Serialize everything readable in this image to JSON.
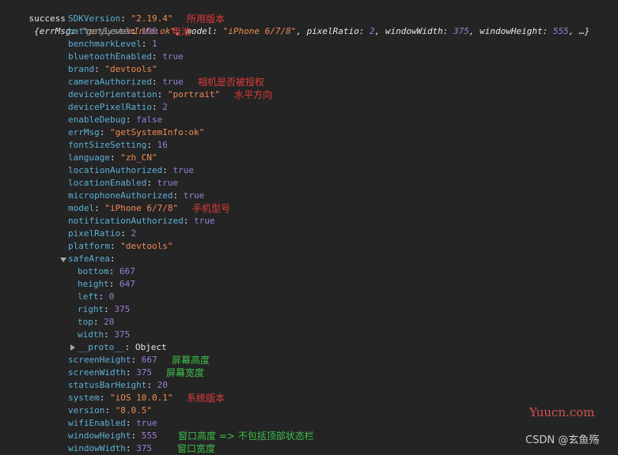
{
  "summary": {
    "label": "success",
    "text_prefix": "{",
    "items": [
      {
        "key": "errMsg",
        "value": "\"getSystemInfo:ok\"",
        "kind": "string"
      },
      {
        "key": "model",
        "value": "\"iPhone 6/7/8\"",
        "kind": "string"
      },
      {
        "key": "pixelRatio",
        "value": "2",
        "kind": "number"
      },
      {
        "key": "windowWidth",
        "value": "375",
        "kind": "number"
      },
      {
        "key": "windowHeight",
        "value": "555",
        "kind": "number"
      }
    ],
    "suffix": ", …}"
  },
  "properties": [
    {
      "key": "SDKVersion",
      "value": "\"2.19.4\"",
      "kind": "string",
      "note": "所用版本",
      "note_color": "red"
    },
    {
      "key": "batteryLevel",
      "value": "100",
      "kind": "number",
      "note": "电池",
      "note_color": "red"
    },
    {
      "key": "benchmarkLevel",
      "value": "1",
      "kind": "number"
    },
    {
      "key": "bluetoothEnabled",
      "value": "true",
      "kind": "bool"
    },
    {
      "key": "brand",
      "value": "\"devtools\"",
      "kind": "string"
    },
    {
      "key": "cameraAuthorized",
      "value": "true",
      "kind": "bool",
      "note": "相机是否被授权",
      "note_color": "red"
    },
    {
      "key": "deviceOrientation",
      "value": "\"portrait\"",
      "kind": "string",
      "note": "水平方向",
      "note_color": "red"
    },
    {
      "key": "devicePixelRatio",
      "value": "2",
      "kind": "number"
    },
    {
      "key": "enableDebug",
      "value": "false",
      "kind": "bool"
    },
    {
      "key": "errMsg",
      "value": "\"getSystemInfo:ok\"",
      "kind": "string"
    },
    {
      "key": "fontSizeSetting",
      "value": "16",
      "kind": "number"
    },
    {
      "key": "language",
      "value": "\"zh_CN\"",
      "kind": "string"
    },
    {
      "key": "locationAuthorized",
      "value": "true",
      "kind": "bool"
    },
    {
      "key": "locationEnabled",
      "value": "true",
      "kind": "bool"
    },
    {
      "key": "microphoneAuthorized",
      "value": "true",
      "kind": "bool"
    },
    {
      "key": "model",
      "value": "\"iPhone 6/7/8\"",
      "kind": "string",
      "note": "手机型号",
      "note_color": "red"
    },
    {
      "key": "notificationAuthorized",
      "value": "true",
      "kind": "bool"
    },
    {
      "key": "pixelRatio",
      "value": "2",
      "kind": "number"
    },
    {
      "key": "platform",
      "value": "\"devtools\"",
      "kind": "string"
    },
    {
      "key": "safeArea",
      "value": "",
      "kind": "expandable"
    },
    {
      "key": "bottom",
      "value": "667",
      "kind": "number",
      "child": true
    },
    {
      "key": "height",
      "value": "647",
      "kind": "number",
      "child": true
    },
    {
      "key": "left",
      "value": "0",
      "kind": "number",
      "child": true
    },
    {
      "key": "right",
      "value": "375",
      "kind": "number",
      "child": true
    },
    {
      "key": "top",
      "value": "20",
      "kind": "number",
      "child": true
    },
    {
      "key": "width",
      "value": "375",
      "kind": "number",
      "child": true
    },
    {
      "key": "__proto__",
      "value": "Object",
      "kind": "object",
      "child": true,
      "collapsed": true
    },
    {
      "key": "screenHeight",
      "value": "667",
      "kind": "number",
      "note": "屏幕高度",
      "note_color": "green"
    },
    {
      "key": "screenWidth",
      "value": "375",
      "kind": "number",
      "note": "屏幕宽度",
      "note_color": "green"
    },
    {
      "key": "statusBarHeight",
      "value": "20",
      "kind": "number"
    },
    {
      "key": "system",
      "value": "\"iOS 10.0.1\"",
      "kind": "string",
      "note": "系统版本",
      "note_color": "red"
    },
    {
      "key": "version",
      "value": "\"8.0.5\"",
      "kind": "string"
    },
    {
      "key": "wifiEnabled",
      "value": "true",
      "kind": "bool"
    },
    {
      "key": "windowHeight",
      "value": "555",
      "kind": "number",
      "note": "窗口高度 => 不包括顶部状态栏",
      "note_color": "green"
    },
    {
      "key": "windowWidth",
      "value": "375",
      "kind": "number",
      "note": "窗口宽度",
      "note_color": "green"
    }
  ],
  "watermarks": {
    "site": "Yuucn.com",
    "credit": "CSDN @玄鱼殇"
  },
  "colors": {
    "background": "#242424",
    "key": "#5db0d7",
    "string": "#f28b54",
    "number": "#9a7fd5",
    "note_red": "#e23a3a",
    "note_green": "#3fbf4a"
  }
}
